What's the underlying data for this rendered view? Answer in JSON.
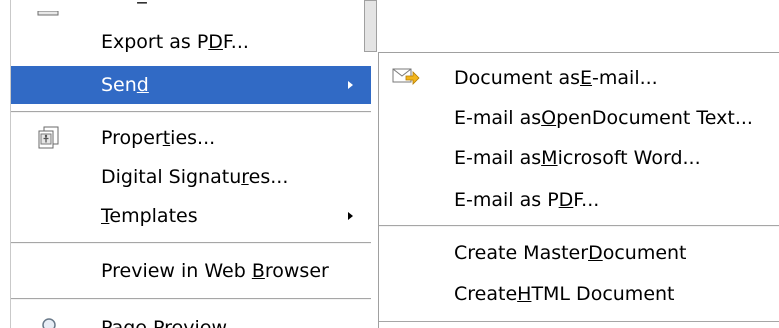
{
  "menu": {
    "export_pdf": {
      "before": "Export as P",
      "key": "D",
      "after": "F..."
    },
    "send": {
      "before": "Sen",
      "key": "d",
      "after": ""
    },
    "properties": {
      "before": "Proper",
      "key": "t",
      "after": "ies..."
    },
    "digital_signatures": {
      "before": "Digital Signatu",
      "key": "r",
      "after": "es..."
    },
    "templates": {
      "before": "",
      "key": "T",
      "after": "emplates"
    },
    "preview_web": {
      "before": "Preview in Web ",
      "key": "B",
      "after": "rowser"
    },
    "page_preview": {
      "before": "Page Preview",
      "key": "",
      "after": ""
    }
  },
  "submenu": {
    "doc_email": {
      "before": "Document as ",
      "key": "E",
      "after": "-mail..."
    },
    "odt": {
      "before": "E-mail as ",
      "key": "O",
      "after": "penDocument Text..."
    },
    "word": {
      "before": "E-mail as ",
      "key": "M",
      "after": "icrosoft Word..."
    },
    "pdf": {
      "before": "E-mail as P",
      "key": "D",
      "after": "F..."
    },
    "master": {
      "before": "Create Master ",
      "key": "D",
      "after": "ocument"
    },
    "html": {
      "before": "Create ",
      "key": "H",
      "after": "TML Document"
    }
  },
  "colors": {
    "highlight": "#316ac5"
  },
  "icons": [
    "mail-arrow-icon",
    "properties-icon",
    "page-preview-icon"
  ]
}
